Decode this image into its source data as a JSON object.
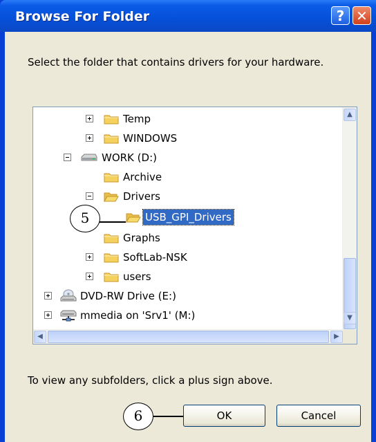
{
  "window": {
    "title": "Browse For Folder",
    "help_label": "?",
    "close_label": "✕"
  },
  "prompt": "Select the folder that contains drivers for your hardware.",
  "tree": {
    "items": [
      {
        "label": "Temp",
        "icon": "folder-icon",
        "expander": "plus"
      },
      {
        "label": "WINDOWS",
        "icon": "folder-icon",
        "expander": "plus"
      },
      {
        "label": "WORK (D:)",
        "icon": "drive-icon",
        "expander": "minus"
      },
      {
        "label": "Archive",
        "icon": "folder-icon",
        "expander": "none"
      },
      {
        "label": "Drivers",
        "icon": "folder-open-icon",
        "expander": "minus"
      },
      {
        "label": "USB_GPI_Drivers",
        "icon": "folder-open-icon",
        "expander": "none",
        "selected": true
      },
      {
        "label": "Graphs",
        "icon": "folder-icon",
        "expander": "none"
      },
      {
        "label": "SoftLab-NSK",
        "icon": "folder-icon",
        "expander": "plus"
      },
      {
        "label": "users",
        "icon": "folder-icon",
        "expander": "plus"
      },
      {
        "label": "DVD-RW Drive (E:)",
        "icon": "dvd-drive-icon",
        "expander": "plus"
      },
      {
        "label": "mmedia on 'Srv1' (M:)",
        "icon": "network-drive-icon",
        "expander": "plus"
      }
    ]
  },
  "hint": "To view any subfolders, click a plus sign above.",
  "buttons": {
    "ok": "OK",
    "cancel": "Cancel"
  },
  "callouts": {
    "five": "5",
    "six": "6"
  },
  "colors": {
    "title_bar": "#0650d8",
    "selection": "#316ac5",
    "dialog_bg": "#ece9d8",
    "close_button": "#d2401c"
  }
}
